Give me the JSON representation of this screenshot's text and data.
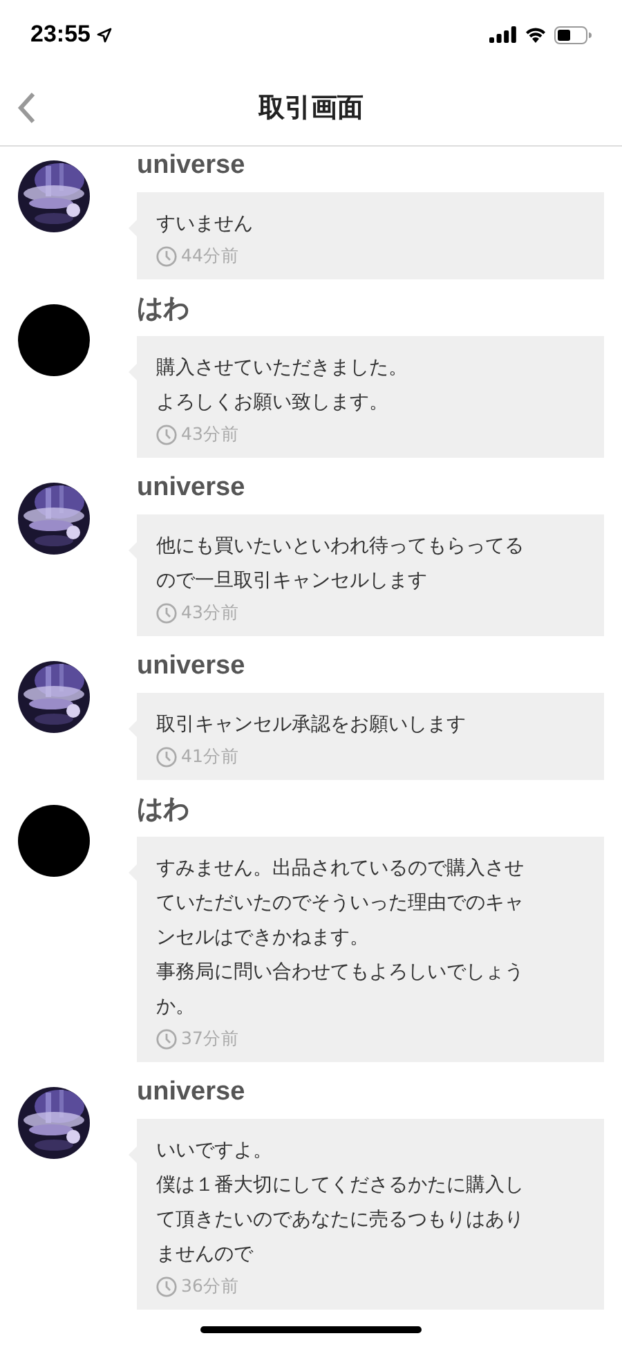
{
  "status_bar": {
    "time": "23:55"
  },
  "header": {
    "title": "取引画面"
  },
  "messages": [
    {
      "sender": "universe",
      "avatar": {
        "kind": "picture"
      },
      "lines": [
        "すいません"
      ],
      "time": "44分前"
    },
    {
      "sender": "はわ",
      "avatar": {
        "kind": "blank"
      },
      "lines": [
        "購入させていただきました。",
        "よろしくお願い致します。"
      ],
      "time": "43分前"
    },
    {
      "sender": "universe",
      "avatar": {
        "kind": "picture"
      },
      "lines": [
        "他にも買いたいといわれ待ってもらってる",
        "ので一旦取引キャンセルします"
      ],
      "time": "43分前"
    },
    {
      "sender": "universe",
      "avatar": {
        "kind": "picture"
      },
      "lines": [
        "取引キャンセル承認をお願いします"
      ],
      "time": "41分前"
    },
    {
      "sender": "はわ",
      "avatar": {
        "kind": "blank"
      },
      "lines": [
        "すみません。出品されているので購入させ",
        "ていただいたのでそういった理由でのキャ",
        "ンセルはできかねます。",
        "事務局に問い合わせてもよろしいでしょう",
        "か。"
      ],
      "time": "37分前"
    },
    {
      "sender": "universe",
      "avatar": {
        "kind": "picture"
      },
      "lines": [
        "いいですよ。",
        "僕は１番大切にしてくださるかたに購入し",
        "て頂きたいのであなたに売るつもりはあり",
        "ませんので"
      ],
      "time": "36分前"
    }
  ]
}
